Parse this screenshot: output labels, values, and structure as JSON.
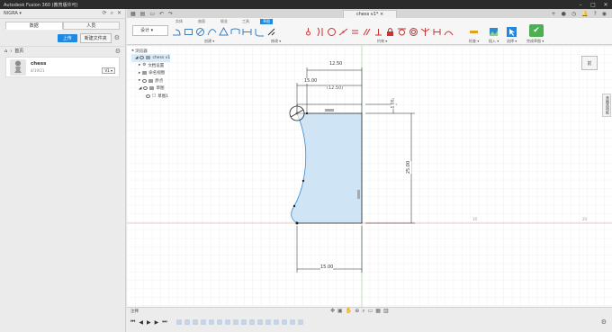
{
  "app": {
    "title": "Autodesk Fusion 360 (教育版许可)"
  },
  "window": {
    "min": "–",
    "max": "□",
    "close": "✕"
  },
  "left_panel": {
    "user": "NIGRA ▾",
    "tabs": [
      "数据",
      "人员"
    ],
    "upload_label": "上传",
    "new_folder_label": "新建文件夹",
    "breadcrumb": "首页",
    "file": {
      "name": "chess",
      "date": "4/19/21",
      "version": "V1 ▾"
    }
  },
  "doc_tab": {
    "title": "chess v1*",
    "close": "×"
  },
  "toolbar": {
    "mode_label": "设计 ▾",
    "tabs": [
      "曲面",
      "钣金",
      "工具",
      "草图"
    ],
    "tab_labels": {
      "solid": "实体",
      "surface": "曲面",
      "sheet": "钣金",
      "tools": "工具",
      "sketch": "草图"
    },
    "sections": {
      "create": "创建 ▾",
      "modify": "修改 ▾",
      "constraints": "约束 ▾",
      "inspect": "检查 ▾",
      "insert": "插入 ▾",
      "select": "选择 ▾",
      "finish": "完成草图 ▾"
    }
  },
  "browser": {
    "header": "浏览器",
    "items": [
      {
        "label": "chess v1",
        "level": 0
      },
      {
        "label": "文档设置",
        "level": 1
      },
      {
        "label": "命名视图",
        "level": 1
      },
      {
        "label": "原点",
        "level": 1
      },
      {
        "label": "草图",
        "level": 1
      },
      {
        "label": "草图1",
        "level": 2
      }
    ]
  },
  "dimensions": {
    "top_width": "12.50",
    "mid_width": "15.00",
    "ref_width": "(12.50)",
    "small_height": "1.00",
    "height": "25.00",
    "bottom_width": "15.00",
    "axis_label_1": "10",
    "axis_label_2": "20"
  },
  "viewcube": {
    "label": "前"
  },
  "side_tab": {
    "label": "草图选项板"
  },
  "bottom": {
    "comments": "注释"
  },
  "colors": {
    "accent": "#1e88e5",
    "finish": "#4caf50",
    "profile_fill": "#cfe4f5",
    "profile_stroke": "#3a8ad0",
    "axis_green": "#7ecf7e",
    "axis_red": "#e88a8a"
  }
}
